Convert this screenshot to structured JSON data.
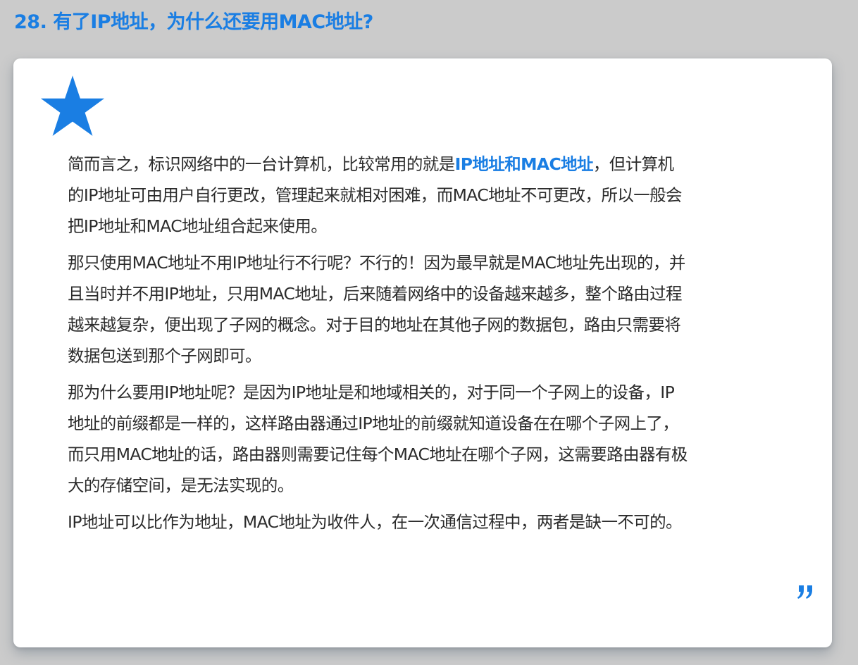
{
  "page_title": "28. 有了IP地址，为什么还要用MAC地址?",
  "colors": {
    "accent": "#1a7ee3",
    "background": "#cbcbcb",
    "card": "#ffffff",
    "text": "#2b2b2b"
  },
  "icons": {
    "star": "star-icon",
    "quote": "closing-quote-icon"
  },
  "content": {
    "p1": {
      "before": "简而言之，标识网络中的一台计算机，比较常用的就是",
      "highlight": "IP地址和MAC地址",
      "after": "，但计算机的IP地址可由用户自行更改，管理起来就相对困难，而MAC地址不可更改，所以一般会把IP地址和MAC地址组合起来使用。"
    },
    "p2": "那只使用MAC地址不用IP地址行不行呢？不行的！因为最早就是MAC地址先出现的，并且当时并不用IP地址，只用MAC地址，后来随着网络中的设备越来越多，整个路由过程越来越复杂，便出现了子网的概念。对于目的地址在其他子网的数据包，路由只需要将数据包送到那个子网即可。",
    "p3": "那为什么要用IP地址呢？是因为IP地址是和地域相关的，对于同一个子网上的设备，IP地址的前缀都是一样的，这样路由器通过IP地址的前缀就知道设备在在哪个子网上了，而只用MAC地址的话，路由器则需要记住每个MAC地址在哪个子网，这需要路由器有极大的存储空间，是无法实现的。",
    "p4": "IP地址可以比作为地址，MAC地址为收件人，在一次通信过程中，两者是缺一不可的。"
  }
}
